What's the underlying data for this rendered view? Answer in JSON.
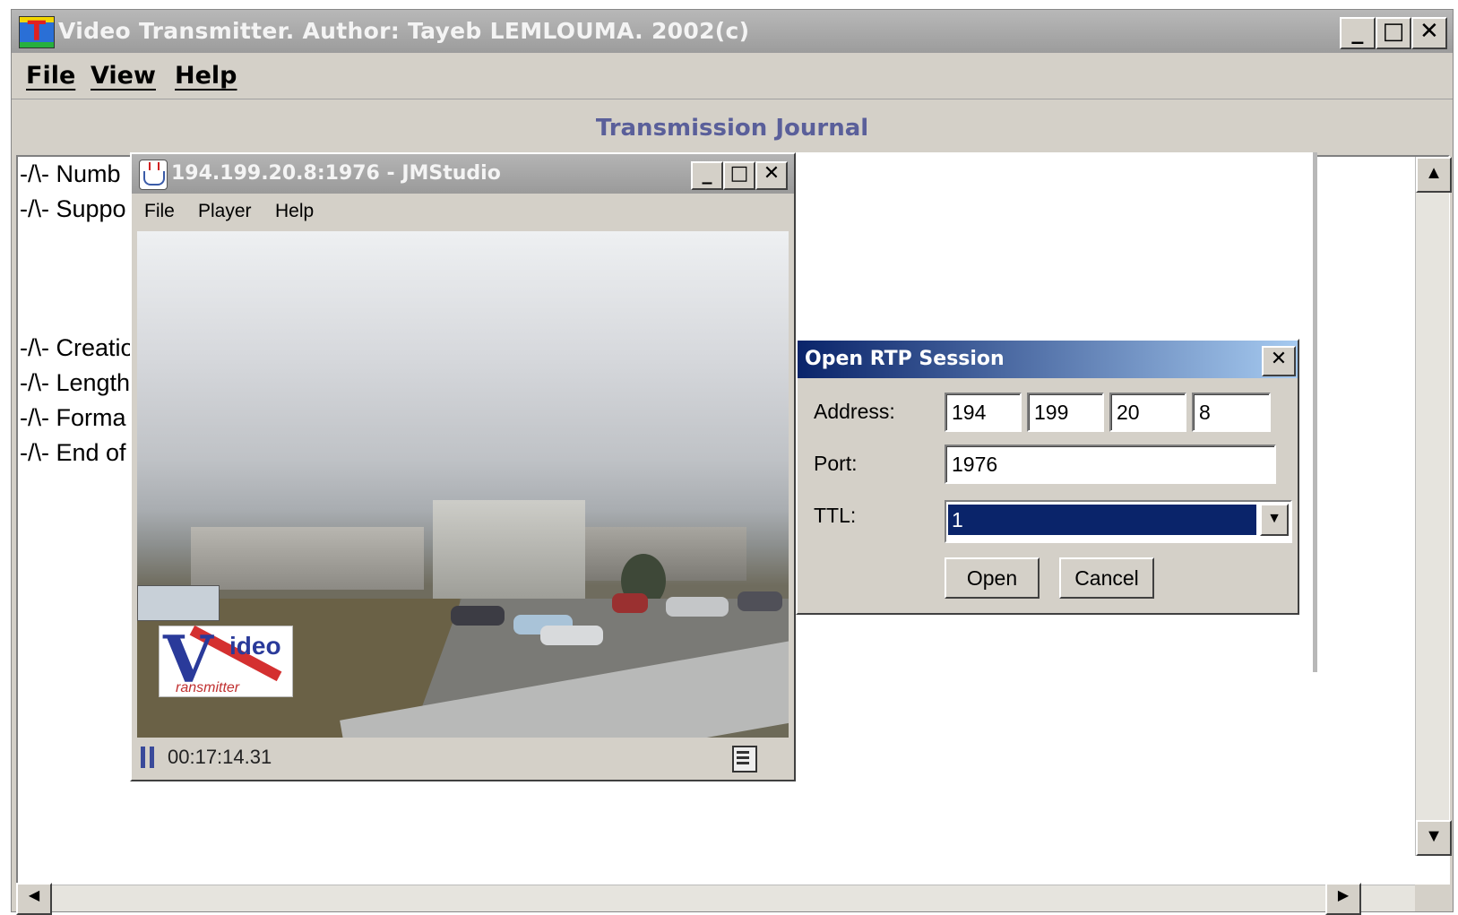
{
  "main_window": {
    "title": "Video Transmitter. Author: Tayeb LEMLOUMA. 2002(c)",
    "menu": [
      "File",
      "View",
      "Help"
    ],
    "journal_title": "Transmission Journal",
    "journal_lines": [
      "-/\\- Numb",
      "-/\\- Suppo",
      "-/\\- Creatio",
      "-/\\- Length",
      "-/\\- Forma",
      "-/\\- End of"
    ],
    "window_buttons": {
      "minimize": "_",
      "maximize": "□",
      "close": "✕"
    }
  },
  "jmstudio": {
    "title": "194.199.20.8:1976 - JMStudio",
    "menu": [
      "File",
      "Player",
      "Help"
    ],
    "timecode": "00:17:14.31",
    "logo": {
      "big_letter": "V",
      "text": "ideo",
      "subtext": "ransmitter"
    }
  },
  "rtp_dialog": {
    "title": "Open RTP Session",
    "address_label": "Address:",
    "address": [
      "194",
      "199",
      "20",
      "8"
    ],
    "port_label": "Port:",
    "port": "1976",
    "ttl_label": "TTL:",
    "ttl_value": "1",
    "open_label": "Open",
    "cancel_label": "Cancel"
  },
  "icons": {
    "app": "video-transmitter-icon",
    "java": "java-cup-icon",
    "pause": "pause-icon",
    "film": "film-strip-icon",
    "dropdown": "chevron-down-icon"
  },
  "colors": {
    "dialog_title_start": "#0a246a",
    "dialog_title_end": "#a6caf0",
    "journal_title": "#5a5f9a",
    "selection": "#0a246a",
    "window_face": "#d4d0c8"
  }
}
